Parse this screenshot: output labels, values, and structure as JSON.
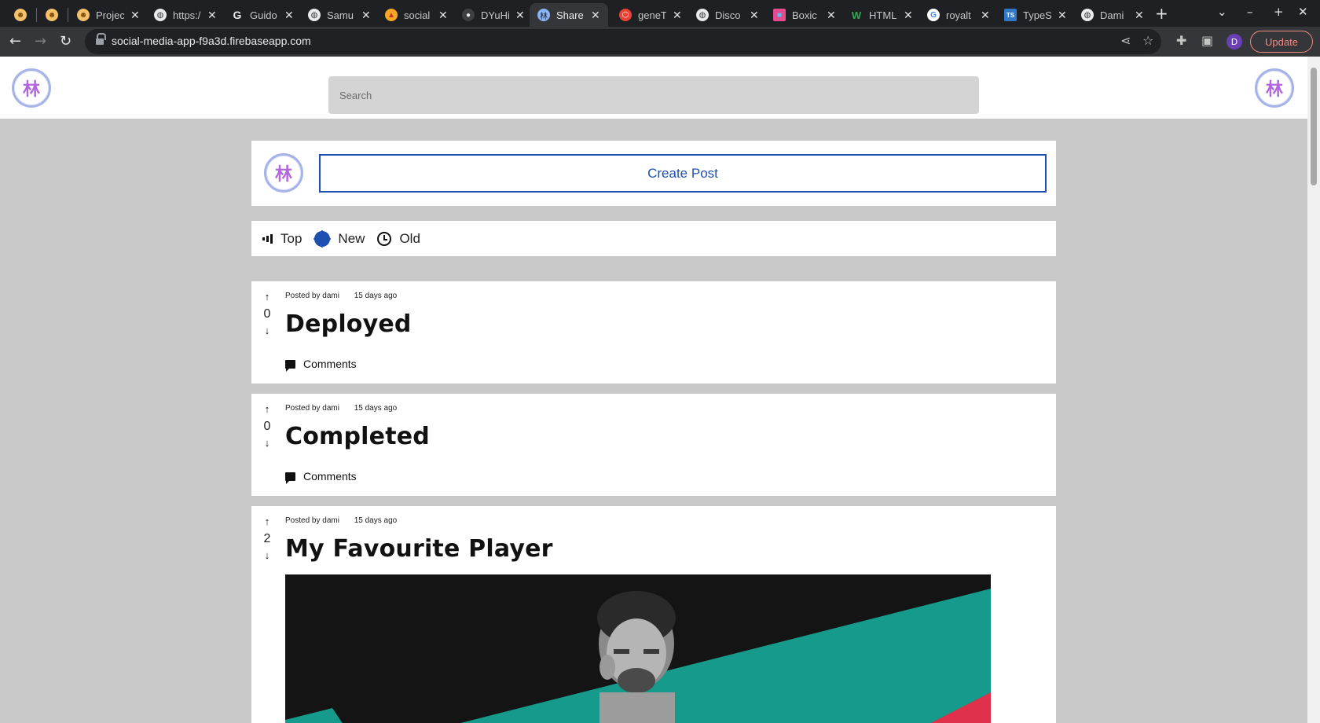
{
  "browser": {
    "tabs": [
      {
        "title": "",
        "favicon": "#f4c06a"
      },
      {
        "title": "",
        "favicon": "#f4c06a"
      },
      {
        "title": "Projec",
        "favicon": "#f4c06a"
      },
      {
        "title": "https:/",
        "favicon": "#e8eaed"
      },
      {
        "title": "Guido",
        "favicon": "#e8eaed"
      },
      {
        "title": "Samu",
        "favicon": "#e8eaed"
      },
      {
        "title": "social",
        "favicon": "#f6a623"
      },
      {
        "title": "DYuHi",
        "favicon": "#3c4043"
      },
      {
        "title": "Share",
        "favicon": "#8ab4f8",
        "active": true
      },
      {
        "title": "geneT",
        "favicon": "#ea4335"
      },
      {
        "title": "Disco",
        "favicon": "#e8eaed"
      },
      {
        "title": "Boxic",
        "favicon": "#e84a8e"
      },
      {
        "title": "HTML",
        "favicon": "#34a853"
      },
      {
        "title": "royalt",
        "favicon": "#4285f4"
      },
      {
        "title": "TypeS",
        "favicon": "#3178c6"
      },
      {
        "title": "Dami",
        "favicon": "#e8eaed"
      }
    ],
    "url": "social-media-app-f9a3d.firebaseapp.com",
    "profile_initial": "D",
    "update_label": "Update"
  },
  "header": {
    "search_placeholder": "Search",
    "logo_glyph": "林"
  },
  "create_post": {
    "label": "Create Post"
  },
  "sort": {
    "options": [
      {
        "label": "Top",
        "icon": "bar-chart-icon"
      },
      {
        "label": "New",
        "icon": "new-badge-icon",
        "selected": true
      },
      {
        "label": "Old",
        "icon": "clock-icon"
      }
    ]
  },
  "posts": [
    {
      "votes": "0",
      "author": "Posted by dami",
      "time": "15 days ago",
      "title": "Deployed",
      "comments_label": "Comments"
    },
    {
      "votes": "0",
      "author": "Posted by dami",
      "time": "15 days ago",
      "title": "Completed",
      "comments_label": "Comments"
    },
    {
      "votes": "2",
      "author": "Posted by dami",
      "time": "15 days ago",
      "title": "My Favourite Player",
      "has_image": true
    }
  ],
  "colors": {
    "accent": "#1d4fb0",
    "page_bg": "#c8c8c8",
    "logo_glyph": "#b266e0"
  }
}
